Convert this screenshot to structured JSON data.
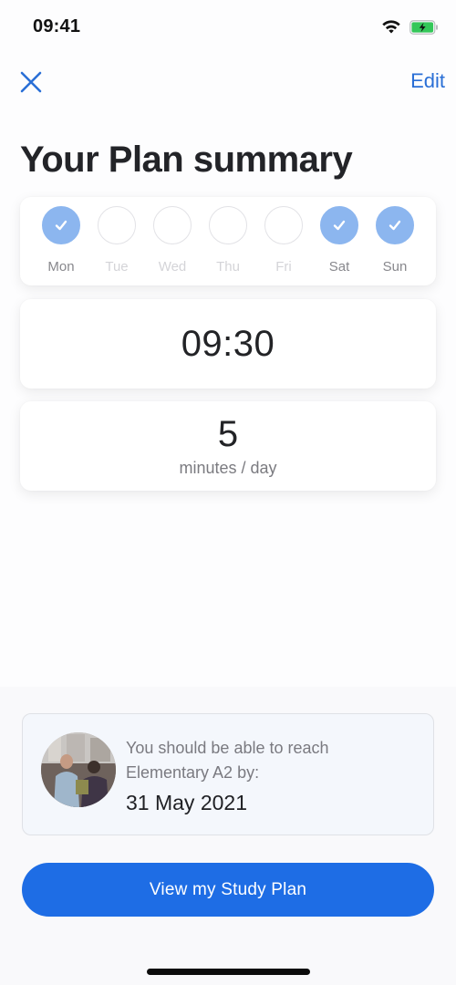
{
  "status_bar": {
    "time": "09:41",
    "wifi_icon": "wifi-icon",
    "battery_icon": "battery-charging-icon",
    "battery_color": "#34c759"
  },
  "nav": {
    "close_icon": "close-icon",
    "edit_label": "Edit",
    "accent_color": "#2a6fd6"
  },
  "page_title": "Your Plan summary",
  "schedule": {
    "days": [
      {
        "label": "Mon",
        "selected": true
      },
      {
        "label": "Tue",
        "selected": false
      },
      {
        "label": "Wed",
        "selected": false
      },
      {
        "label": "Thu",
        "selected": false
      },
      {
        "label": "Fri",
        "selected": false
      },
      {
        "label": "Sat",
        "selected": true
      },
      {
        "label": "Sun",
        "selected": true
      }
    ],
    "selected_color": "#8cb6ef"
  },
  "reminder": {
    "time": "09:30"
  },
  "duration": {
    "value": "5",
    "unit": "minutes / day"
  },
  "goal": {
    "line1": "You should be able to reach",
    "line2": "Elementary A2 by:",
    "date": "31 May 2021",
    "avatar": "learners-photo"
  },
  "cta": {
    "label": "View my Study Plan",
    "color": "#1e6de5"
  }
}
